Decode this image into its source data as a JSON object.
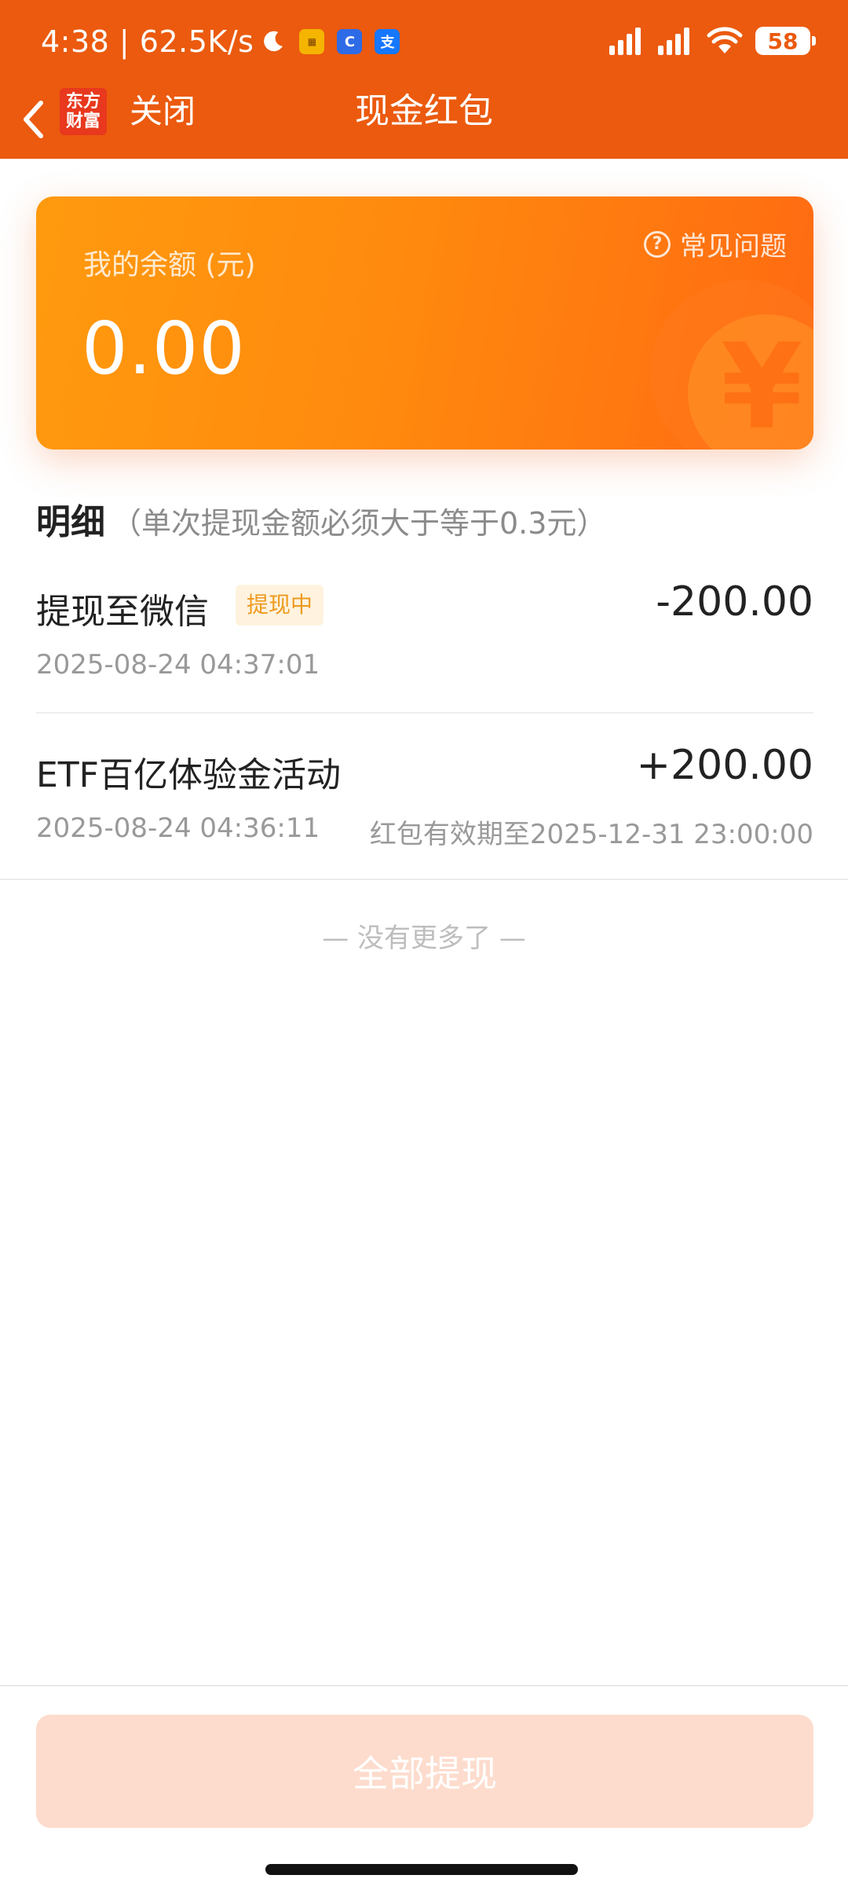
{
  "status_bar": {
    "time_speed": "4:38 | 62.5K/s",
    "battery": "58",
    "icons": [
      "moon-icon",
      "app-notification-icon",
      "browser-icon",
      "alipay-icon",
      "signal-icon",
      "signal-icon",
      "wifi-icon",
      "battery-icon"
    ]
  },
  "nav": {
    "back_icon": "chevron-left-icon",
    "logo_line1": "东方",
    "logo_line2": "财富",
    "close_label": "关闭",
    "title": "现金红包"
  },
  "balance_card": {
    "label": "我的余额 (元)",
    "value": "0.00",
    "faq_icon": "?",
    "faq_label": "常见问题",
    "coin_symbol": "¥"
  },
  "detail": {
    "title": "明细",
    "note": "（单次提现金额必须大于等于0.3元）",
    "records": [
      {
        "title": "提现至微信",
        "badge": "提现中",
        "amount": "-200.00",
        "time": "2025-08-24 04:37:01"
      },
      {
        "title": "ETF百亿体验金活动",
        "amount": "+200.00",
        "time": "2025-08-24 04:36:11",
        "expire": "红包有效期至2025-12-31 23:00:00"
      }
    ],
    "no_more": "— 没有更多了 —"
  },
  "footer": {
    "withdraw_all_label": "全部提现"
  },
  "colors": {
    "header": "#EB5A0E",
    "card_start": "#FF9A0E",
    "card_end": "#FF6A12",
    "badge_text": "#EE9A1E",
    "button_disabled": "#FDDCCD"
  }
}
